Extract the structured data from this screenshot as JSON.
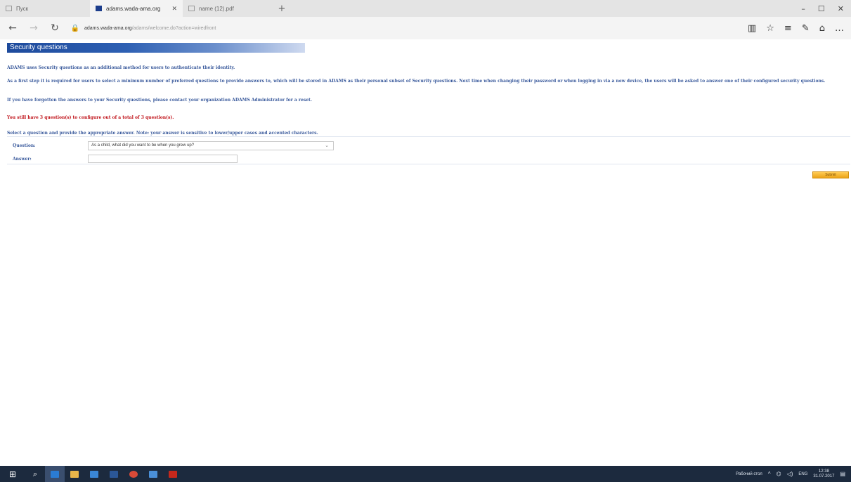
{
  "browser": {
    "tabs": [
      {
        "label": "Пуск",
        "active": false
      },
      {
        "label": "adams.wada-ama.org",
        "active": true
      },
      {
        "label": "name (12).pdf",
        "active": false
      }
    ],
    "new_tab_icon": "plus-icon",
    "window_controls": {
      "minimize": "–",
      "maximize": "☐",
      "close": "✕"
    },
    "address": {
      "domain": "adams.wada-ama.org",
      "path": "/adams/welcome.do?action=wiredfront",
      "prefix": "adams."
    }
  },
  "page": {
    "section_title": "Security questions",
    "intro": "ADAMS uses Security questions as an additional method for users to authenticate their identity.",
    "step_text": "As a first step it is required for users to select a minimum number of preferred questions to provide answers to, which will be stored in ADAMS as their personal subset of Security questions. Next time when changing their password or when logging in via a new device, the users will be asked to answer one of their configured security questions.",
    "forgot_text": "If you have forgotten the answers to your Security questions, please contact your organization ADAMS Administrator for a reset.",
    "remaining_text": "You still have 3 question(s) to configure out of a total of 3 question(s).",
    "select_text": "Select a question and provide the appropriate answer. Note: your answer is sensitive to lower/upper cases and accented characters.",
    "form": {
      "question_label": "Question:",
      "question_value": "As a child, what did you want to be when you grew up?",
      "answer_label": "Answer:",
      "answer_value": ""
    },
    "submit_label": "Submit"
  },
  "taskbar": {
    "tray_text": "Рабочий стол",
    "lang": "ENG",
    "time": "12:38",
    "date": "31.07.2017"
  },
  "colors": {
    "header_blue": "#1d4a9c",
    "text_blue": "#3a5a9c",
    "warning_red": "#c0141b",
    "submit_orange": "#eba418"
  }
}
